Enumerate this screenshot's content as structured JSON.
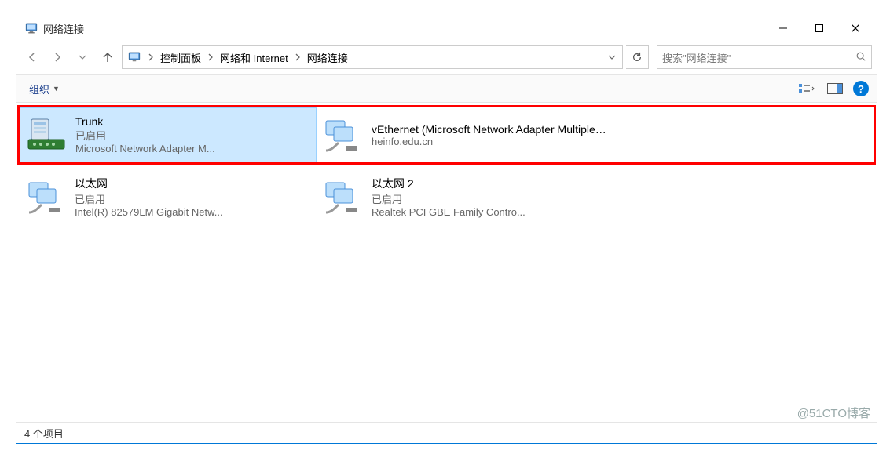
{
  "window": {
    "title": "网络连接"
  },
  "breadcrumb": {
    "items": [
      "控制面板",
      "网络和 Internet",
      "网络连接"
    ]
  },
  "search": {
    "placeholder": "搜索\"网络连接\""
  },
  "toolbar": {
    "organize": "组织"
  },
  "connections": [
    {
      "name": "Trunk",
      "status": "已启用",
      "desc": "Microsoft Network Adapter M..."
    },
    {
      "name": "vEthernet (Microsoft Network Adapter Multiplexor Driver - V...",
      "status": "heinfo.edu.cn",
      "desc": ""
    },
    {
      "name": "以太网",
      "status": "已启用",
      "desc": "Intel(R) 82579LM Gigabit Netw..."
    },
    {
      "name": "以太网 2",
      "status": "已启用",
      "desc": "Realtek PCI GBE Family Contro..."
    }
  ],
  "statusbar": {
    "text": "4 个项目"
  },
  "watermark": "@51CTO博客"
}
